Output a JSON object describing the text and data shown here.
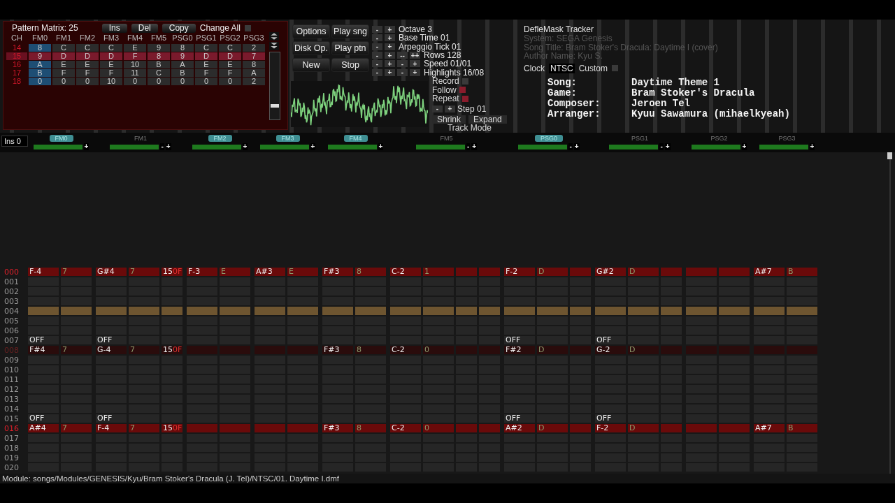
{
  "pattern_matrix": {
    "title": "Pattern Matrix: 25",
    "buttons": [
      "Ins",
      "Del",
      "Copy"
    ],
    "change_all": {
      "label": "Change All",
      "checked": false
    },
    "header": "CH",
    "columns": [
      {
        "label": "FM0",
        "selected": true
      },
      {
        "label": "FM1",
        "selected": false
      },
      {
        "label": "FM2",
        "selected": false
      },
      {
        "label": "FM3",
        "selected": false
      },
      {
        "label": "FM4",
        "selected": false
      },
      {
        "label": "FM5",
        "selected": false
      },
      {
        "label": "PSG0",
        "selected": false
      },
      {
        "label": "PSG1",
        "selected": false
      },
      {
        "label": "PSG2",
        "selected": false
      },
      {
        "label": "PSG3",
        "selected": false
      }
    ],
    "rows": [
      {
        "number": "14",
        "selected": false,
        "cells": [
          "8",
          "C",
          "C",
          "C",
          "E",
          "9",
          "8",
          "C",
          "C",
          "2"
        ]
      },
      {
        "number": "15",
        "selected": true,
        "cells": [
          "9",
          "D",
          "D",
          "D",
          "F",
          "8",
          "9",
          "D",
          "D",
          "7"
        ]
      },
      {
        "number": "16",
        "selected": false,
        "cells": [
          "A",
          "E",
          "E",
          "E",
          "10",
          "B",
          "A",
          "E",
          "E",
          "8"
        ]
      },
      {
        "number": "17",
        "selected": false,
        "cells": [
          "B",
          "F",
          "F",
          "F",
          "11",
          "C",
          "B",
          "F",
          "F",
          "A"
        ]
      },
      {
        "number": "18",
        "selected": false,
        "cells": [
          "0",
          "0",
          "0",
          "10",
          "0",
          "0",
          "0",
          "0",
          "0",
          "2"
        ]
      }
    ]
  },
  "controls": {
    "buttons": [
      "Options",
      "Play sng",
      "Disk Op.",
      "Play ptn",
      "New",
      "Stop"
    ],
    "settings": [
      {
        "buttons": [
          "-",
          "+"
        ],
        "label": "Octave 3"
      },
      {
        "buttons": [
          "-",
          "+"
        ],
        "label": "Base Time 01"
      },
      {
        "buttons": [
          "-",
          "+"
        ],
        "label": "Arpeggio Tick 01"
      },
      {
        "buttons": [
          "-",
          "+",
          "--",
          "++"
        ],
        "label": "Rows 128"
      },
      {
        "buttons": [
          "-",
          "+",
          "-",
          "+"
        ],
        "label": "Speed 01/01"
      },
      {
        "buttons": [
          "-",
          "+",
          "-",
          "+"
        ],
        "label": "Highlights 16/08"
      }
    ],
    "toggles": [
      {
        "label": "Record",
        "checked": false
      },
      {
        "label": "Follow",
        "checked": true
      },
      {
        "label": "Repeat",
        "checked": true
      }
    ],
    "step": {
      "buttons": [
        "-",
        "+"
      ],
      "label": "Step 01"
    },
    "track_mode": {
      "buttons": [
        "Shrink",
        "Expand"
      ],
      "label": "Track Mode"
    }
  },
  "info": {
    "title": "DefleMask Tracker",
    "lines": [
      "System: SEGA Genesis",
      "Song Title: Bram Stoker's Dracula: Daytime I (cover)",
      "Author Name: Kyu S."
    ],
    "clock_label": "Clock",
    "clock_value": "NTSC",
    "custom": {
      "label": "Custom",
      "checked": false
    }
  },
  "song_card": [
    {
      "label": "Song:",
      "value": "Daytime Theme 1"
    },
    {
      "label": "Game:",
      "value": "Bram Stoker's Dracula"
    },
    {
      "label": "Composer:",
      "value": "Jeroen Tel"
    },
    {
      "label": "Arranger:",
      "value": "Kyuu Sawamura (mihaelkyeah)"
    }
  ],
  "instrument": "Ins 0",
  "channels": [
    {
      "name": "FM0",
      "active": true,
      "buttons": [
        "+"
      ]
    },
    {
      "name": "FM1",
      "active": false,
      "buttons": [
        "-",
        "+"
      ]
    },
    {
      "name": "FM2",
      "active": true,
      "buttons": [
        "+"
      ]
    },
    {
      "name": "FM3",
      "active": true,
      "buttons": [
        "+"
      ]
    },
    {
      "name": "FM4",
      "active": true,
      "buttons": [
        "+"
      ]
    },
    {
      "name": "FM5",
      "active": false,
      "buttons": [
        "-",
        "+"
      ]
    },
    {
      "name": "PSG0",
      "active": true,
      "buttons": [
        "-",
        "+"
      ]
    },
    {
      "name": "PSG1",
      "active": false,
      "buttons": [
        "-",
        "+"
      ]
    },
    {
      "name": "PSG2",
      "active": false,
      "buttons": [
        "+"
      ]
    },
    {
      "name": "PSG3",
      "active": false,
      "buttons": [
        "+"
      ]
    }
  ],
  "rows": [
    {
      "number": "000",
      "kind": "beat",
      "cells": [
        {
          "note": "F-4",
          "ins": "7"
        },
        {
          "note": "G#4",
          "ins": "7",
          "effect": "15",
          "effect_value": "0F"
        },
        {
          "note": "F-3",
          "ins": "E"
        },
        {
          "note": "A#3",
          "ins": "E"
        },
        {
          "note": "F#3",
          "ins": "8"
        },
        {
          "note": "C-2",
          "ins": "1"
        },
        {
          "note": "F-2",
          "ins": "D"
        },
        {
          "note": "G#2",
          "ins": "D"
        },
        {},
        {
          "note": "A#7",
          "ins": "B"
        }
      ]
    },
    {
      "number": "001",
      "kind": "normal"
    },
    {
      "number": "002",
      "kind": "normal"
    },
    {
      "number": "003",
      "kind": "normal"
    },
    {
      "number": "004",
      "kind": "cursor"
    },
    {
      "number": "005",
      "kind": "normal"
    },
    {
      "number": "006",
      "kind": "normal"
    },
    {
      "number": "007",
      "kind": "normal",
      "cells": [
        {
          "note": "OFF"
        },
        {
          "note": "OFF"
        },
        {},
        {},
        {},
        {},
        {
          "note": "OFF"
        },
        {
          "note": "OFF"
        },
        {},
        {}
      ]
    },
    {
      "number": "008",
      "kind": "half",
      "cells": [
        {
          "note": "F#4",
          "ins": "7"
        },
        {
          "note": "G-4",
          "ins": "7",
          "effect": "15",
          "effect_value": "0F"
        },
        {},
        {},
        {
          "note": "F#3",
          "ins": "8"
        },
        {
          "note": "C-2",
          "ins": "0"
        },
        {
          "note": "F#2",
          "ins": "D"
        },
        {
          "note": "G-2",
          "ins": "D"
        },
        {},
        {}
      ]
    },
    {
      "number": "009",
      "kind": "normal"
    },
    {
      "number": "010",
      "kind": "normal"
    },
    {
      "number": "011",
      "kind": "normal"
    },
    {
      "number": "012",
      "kind": "normal"
    },
    {
      "number": "013",
      "kind": "normal"
    },
    {
      "number": "014",
      "kind": "normal"
    },
    {
      "number": "015",
      "kind": "normal",
      "cells": [
        {
          "note": "OFF"
        },
        {
          "note": "OFF"
        },
        {},
        {},
        {},
        {},
        {
          "note": "OFF"
        },
        {
          "note": "OFF"
        },
        {},
        {}
      ]
    },
    {
      "number": "016",
      "kind": "beat",
      "cells": [
        {
          "note": "A#4",
          "ins": "7"
        },
        {
          "note": "F-4",
          "ins": "7",
          "effect": "15",
          "effect_value": "0F"
        },
        {},
        {},
        {
          "note": "F#3",
          "ins": "8"
        },
        {
          "note": "C-2",
          "ins": "0"
        },
        {
          "note": "A#2",
          "ins": "D"
        },
        {
          "note": "F-2",
          "ins": "D"
        },
        {},
        {
          "note": "A#7",
          "ins": "B"
        }
      ]
    },
    {
      "number": "017",
      "kind": "normal"
    },
    {
      "number": "018",
      "kind": "normal"
    },
    {
      "number": "019",
      "kind": "normal"
    },
    {
      "number": "020",
      "kind": "normal"
    }
  ],
  "status_bar": "Module: songs/Modules/GENESIS/Kyu/Bram Stoker's Dracula (J. Tel)/NTSC/01. Daytime I.dmf"
}
